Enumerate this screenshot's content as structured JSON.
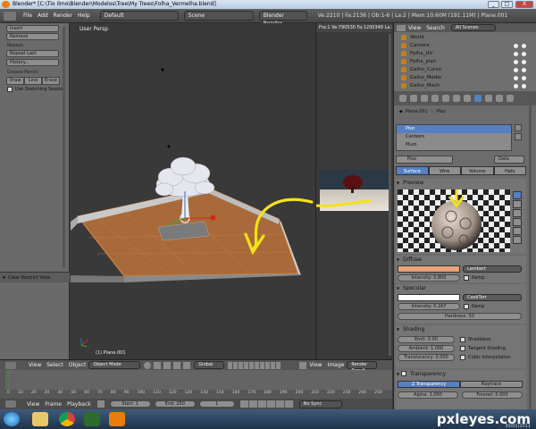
{
  "window": {
    "title": "Blender* [C:\\Tio Ilmo\\Blender\\Modelos\\Tree\\My Trees\\Folha_Vermelha.blend]",
    "min": "_",
    "max": "□",
    "close": "X"
  },
  "info_header": {
    "menus": [
      "File",
      "Add",
      "Render",
      "Help"
    ],
    "layout": "Default",
    "scene": "Scene",
    "engine": "Blender Render",
    "stats": "Ve:2210 | Fa:2136 | Ob:1-6 | La:2 | Mem:10.60M (191.11M) | Plane.001"
  },
  "toolshelf": {
    "buttons_top": [
      "Insert",
      "Remove"
    ],
    "repeat_label": "Repeat:",
    "repeat_last": "Repeat Last",
    "history": "History...",
    "grease_label": "Grease Pencil:",
    "grease_buttons": [
      "Draw",
      "Line",
      "Erase"
    ],
    "use_sketching": "Use Sketching Sessio",
    "clear_restrict": "Clear Restrict View"
  },
  "viewport": {
    "label": "User Persp",
    "object_label": "(1) Plane.001",
    "header": {
      "view": "View",
      "select": "Select",
      "object": "Object",
      "mode": "Object Mode",
      "transform": "Global"
    }
  },
  "image_editor": {
    "info": "Fra:1  Ve:790530 Fa:1200348  La:1",
    "view": "View",
    "image": "Image",
    "result": "Render Result"
  },
  "outliner": {
    "view": "View",
    "search": "Search",
    "scenes": "All Scenes",
    "items": [
      "World",
      "Camera",
      "Folha_UV",
      "Folha_plan",
      "Galho_Curvo",
      "Galho_Medio",
      "Galho_Mech"
    ]
  },
  "properties": {
    "breadcrumb_obj": "Plane.001",
    "breadcrumb_mat": "Piso",
    "materials": [
      "Piso",
      "Canteiro",
      "Muro"
    ],
    "material_name": "Piso",
    "data_label": "Data",
    "tabs": [
      "Surface",
      "Wire",
      "Volume",
      "Halo"
    ],
    "preview_label": "Preview",
    "diffuse": {
      "label": "Diffuse",
      "shader": "Lambert",
      "intensity": "Intensity: 0.800",
      "ramp": "Ramp",
      "color": "#e8a27a"
    },
    "specular": {
      "label": "Specular",
      "shader": "CookTorr",
      "intensity": "Intensity: 0.167",
      "ramp": "Ramp",
      "hardness": "Hardness: 50",
      "color": "#ffffff"
    },
    "shading": {
      "label": "Shading",
      "emit": "Emit: 0.00",
      "ambient": "Ambient: 1.000",
      "translucency": "Translucency: 0.000",
      "shadeless": "Shadeless",
      "tangent": "Tangent Shading",
      "cubic": "Cubic Interpolation"
    },
    "transparency": {
      "label": "Transparency",
      "ztransp": "Z Transparency",
      "raytrace": "Raytrace",
      "alpha": "Alpha: 1.000",
      "fresnel": "Fresnel: 0.000"
    }
  },
  "timeline": {
    "ticks": [
      "0",
      "10",
      "20",
      "30",
      "40",
      "50",
      "60",
      "70",
      "80",
      "90",
      "100",
      "110",
      "120",
      "130",
      "140",
      "150",
      "160",
      "170",
      "180",
      "190",
      "200",
      "210",
      "220",
      "230",
      "240",
      "250"
    ],
    "header": {
      "view": "View",
      "frame": "Frame",
      "playback": "Playback",
      "start": "Start: 1",
      "end": "End: 250",
      "current": "1",
      "sync": "No Sync"
    }
  },
  "taskbar": {
    "watermark": "pxleyes.com",
    "date": "30/01/2011"
  },
  "colors": {
    "accent_blue": "#5680c2",
    "diffuse_orange": "#e8a27a",
    "annotation_yellow": "#f4e21a"
  }
}
